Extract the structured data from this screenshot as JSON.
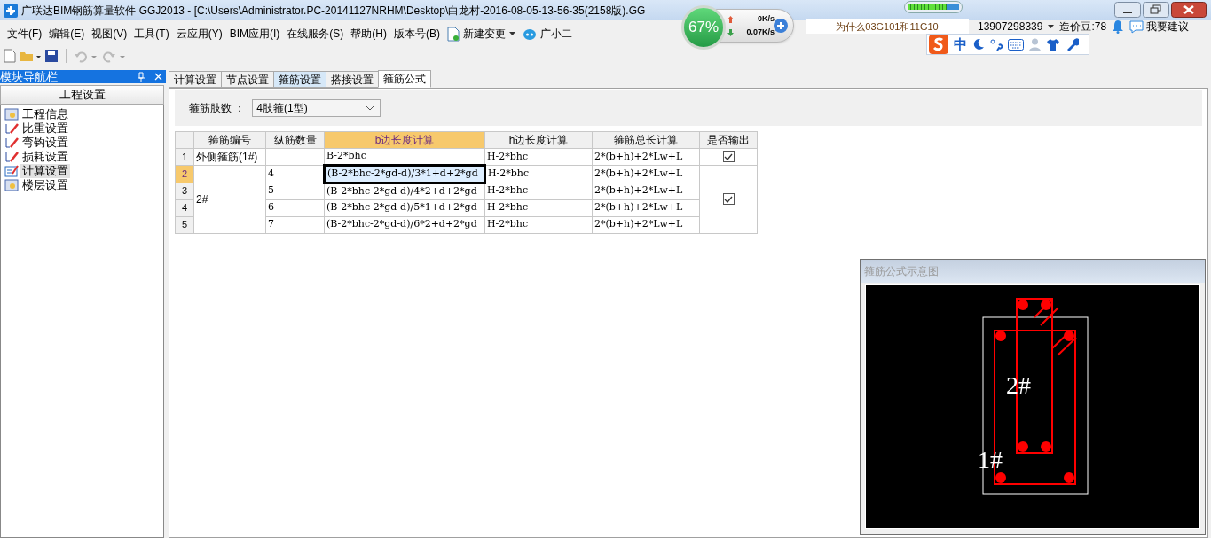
{
  "window": {
    "title": "广联达BIM钢筋算量软件 GGJ2013 - [C:\\Users\\Administrator.PC-20141127NRHM\\Desktop\\白龙村-2016-08-05-13-56-35(2158版).GG"
  },
  "menu": [
    "文件(F)",
    "编辑(E)",
    "视图(V)",
    "工具(T)",
    "云应用(Y)",
    "BIM应用(I)",
    "在线服务(S)",
    "帮助(H)",
    "版本号(B)"
  ],
  "menu_extras": [
    {
      "kind": "doc",
      "label": "新建变更"
    },
    {
      "kind": "bot",
      "label": "广小二"
    }
  ],
  "account": {
    "notice": "为什么03G101和11G10",
    "phone": "13907298339",
    "beans": "造价豆:78",
    "suggest": "我要建议"
  },
  "net_widget": {
    "percent": "67%",
    "up": "0K/s",
    "down": "0.07K/s"
  },
  "top_meter": {
    "level": 0.75
  },
  "ime": {
    "mode": "中"
  },
  "sidebar": {
    "title": "模块导航栏",
    "section": "工程设置",
    "items": [
      {
        "label": "工程信息",
        "kind": "info",
        "selected": false
      },
      {
        "label": "比重设置",
        "kind": "pen",
        "selected": false
      },
      {
        "label": "弯钩设置",
        "kind": "pen",
        "selected": false
      },
      {
        "label": "损耗设置",
        "kind": "pen",
        "selected": false
      },
      {
        "label": "计算设置",
        "kind": "form",
        "selected": true
      },
      {
        "label": "楼层设置",
        "kind": "info",
        "selected": false
      }
    ]
  },
  "tabs": [
    {
      "label": "计算设置",
      "selected": false,
      "hovered": false
    },
    {
      "label": "节点设置",
      "selected": false,
      "hovered": false
    },
    {
      "label": "箍筋设置",
      "selected": false,
      "hovered": true
    },
    {
      "label": "搭接设置",
      "selected": false,
      "hovered": false
    },
    {
      "label": "箍筋公式",
      "selected": true,
      "hovered": false
    }
  ],
  "legs_field": {
    "label": "箍筋肢数 ：",
    "value": "4肢箍(1型)"
  },
  "table": {
    "columns": [
      {
        "label": "箍筋编号",
        "selected": false
      },
      {
        "label": "纵筋数量",
        "selected": false
      },
      {
        "label": "b边长度计算",
        "selected": true
      },
      {
        "label": "h边长度计算",
        "selected": false
      },
      {
        "label": "箍筋总长计算",
        "selected": false
      },
      {
        "label": "是否输出",
        "selected": false
      }
    ],
    "groups": [
      {
        "label": "外侧箍筋(1#)",
        "output": true,
        "rows": [
          {
            "number": "1",
            "bars": "",
            "b": "B-2*bhc",
            "h": "H-2*bhc",
            "total": "2*(b+h)+2*Lw+L",
            "selected": false
          }
        ]
      },
      {
        "label": "2#",
        "output": true,
        "rows": [
          {
            "number": "2",
            "bars": "4",
            "b": "(B-2*bhc-2*gd-d)/3*1+d+2*gd",
            "h": "H-2*bhc",
            "total": "2*(b+h)+2*Lw+L",
            "selected": true
          },
          {
            "number": "3",
            "bars": "5",
            "b": "(B-2*bhc-2*gd-d)/4*2+d+2*gd",
            "h": "H-2*bhc",
            "total": "2*(b+h)+2*Lw+L",
            "selected": false
          },
          {
            "number": "4",
            "bars": "6",
            "b": "(B-2*bhc-2*gd-d)/5*1+d+2*gd",
            "h": "H-2*bhc",
            "total": "2*(b+h)+2*Lw+L",
            "selected": false
          },
          {
            "number": "5",
            "bars": "7",
            "b": "(B-2*bhc-2*gd-d)/6*2+d+2*gd",
            "h": "H-2*bhc",
            "total": "2*(b+h)+2*Lw+L",
            "selected": false
          }
        ]
      }
    ]
  },
  "diagram": {
    "title": "箍筋公式示意图",
    "labels": [
      "2#",
      "1#"
    ]
  }
}
